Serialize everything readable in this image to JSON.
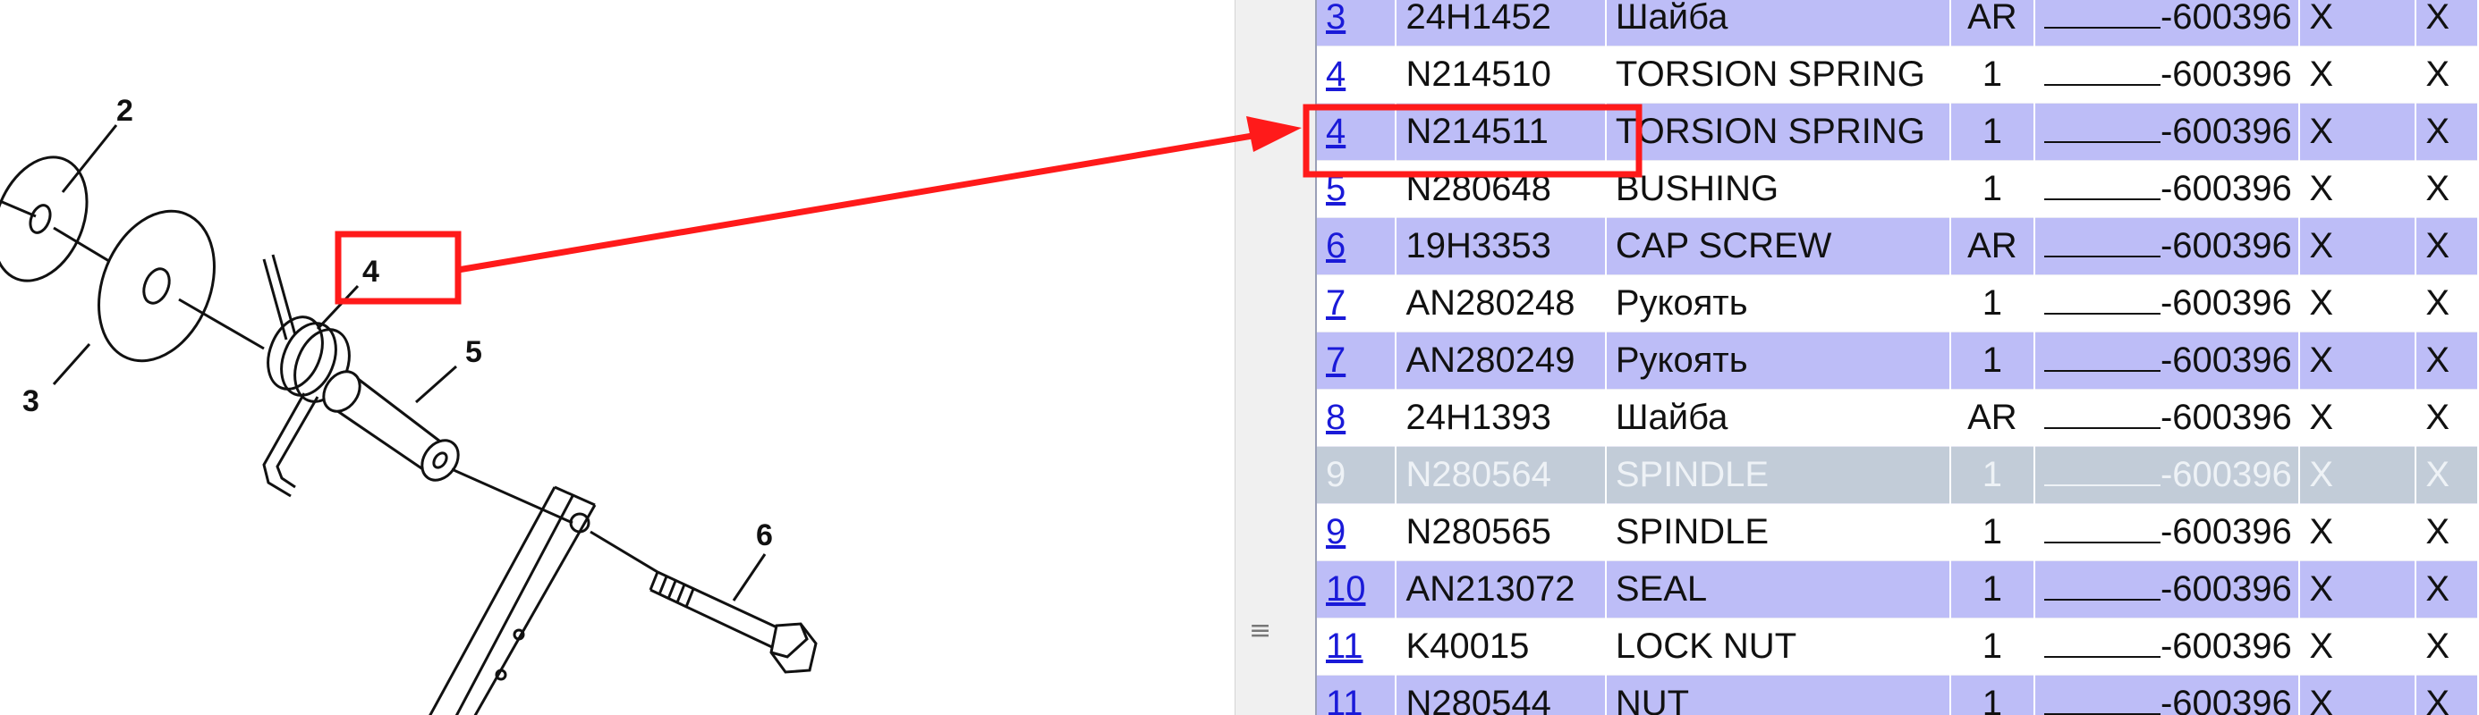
{
  "diagram": {
    "callouts": [
      "2",
      "3",
      "4",
      "5",
      "6"
    ]
  },
  "parts_table": {
    "rows": [
      {
        "item": "3",
        "part_no": "24H1452",
        "description": "Шайба",
        "qty": "AR",
        "serial": "-600396",
        "col_a": "X",
        "col_b": "X"
      },
      {
        "item": "4",
        "part_no": "N214510",
        "description": "TORSION SPRING",
        "qty": "1",
        "serial": "-600396",
        "col_a": "X",
        "col_b": "X"
      },
      {
        "item": "4",
        "part_no": "N214511",
        "description": "TORSION SPRING",
        "qty": "1",
        "serial": "-600396",
        "col_a": "X",
        "col_b": "X"
      },
      {
        "item": "5",
        "part_no": "N280648",
        "description": "BUSHING",
        "qty": "1",
        "serial": "-600396",
        "col_a": "X",
        "col_b": "X"
      },
      {
        "item": "6",
        "part_no": "19H3353",
        "description": "CAP SCREW",
        "qty": "AR",
        "serial": "-600396",
        "col_a": "X",
        "col_b": "X"
      },
      {
        "item": "7",
        "part_no": "AN280248",
        "description": "Рукоять",
        "qty": "1",
        "serial": "-600396",
        "col_a": "X",
        "col_b": "X"
      },
      {
        "item": "7",
        "part_no": "AN280249",
        "description": "Рукоять",
        "qty": "1",
        "serial": "-600396",
        "col_a": "X",
        "col_b": "X"
      },
      {
        "item": "8",
        "part_no": "24H1393",
        "description": "Шайба",
        "qty": "AR",
        "serial": "-600396",
        "col_a": "X",
        "col_b": "X"
      },
      {
        "item": "9",
        "part_no": "N280564",
        "description": "SPINDLE",
        "qty": "1",
        "serial": "-600396",
        "col_a": "X",
        "col_b": "X"
      },
      {
        "item": "9",
        "part_no": "N280565",
        "description": "SPINDLE",
        "qty": "1",
        "serial": "-600396",
        "col_a": "X",
        "col_b": "X"
      },
      {
        "item": "10",
        "part_no": "AN213072",
        "description": "SEAL",
        "qty": "1",
        "serial": "-600396",
        "col_a": "X",
        "col_b": "X"
      },
      {
        "item": "11",
        "part_no": "K40015",
        "description": "LOCK NUT",
        "qty": "1",
        "serial": "-600396",
        "col_a": "X",
        "col_b": "X"
      },
      {
        "item": "11",
        "part_no": "N280544",
        "description": "NUT",
        "qty": "1",
        "serial": "-600396",
        "col_a": "X",
        "col_b": "X"
      }
    ]
  },
  "splitter": {
    "grip_glyph": "≡"
  },
  "colors": {
    "annotation": "#ff1a1a",
    "row_alt": "#bdbdf7",
    "row_selected": "#c2ccd8",
    "link": "#1a1ad8"
  }
}
